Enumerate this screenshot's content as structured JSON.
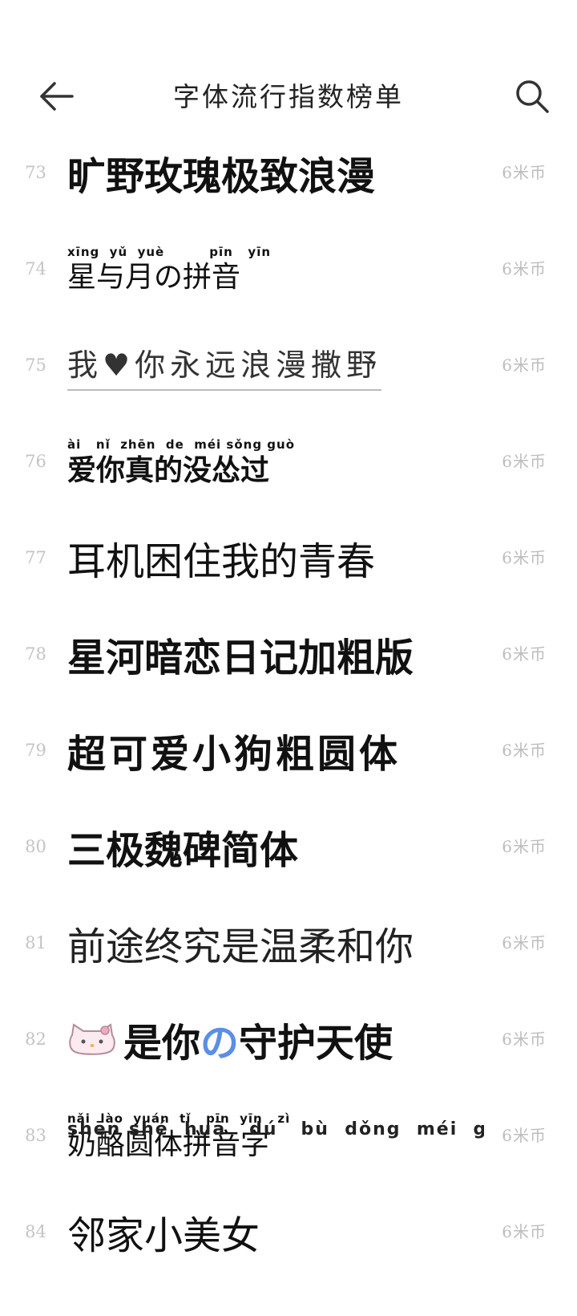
{
  "header": {
    "title": "字体流行指数榜单",
    "back_icon": "arrow-left-icon",
    "search_icon": "search-icon"
  },
  "fonts": [
    {
      "rank": "73",
      "name": "旷野玫瑰极致浪漫",
      "price": "6米币",
      "style": "bold"
    },
    {
      "rank": "74",
      "name": "星与月の拼音",
      "pinyin": "xīng  yǔ  yuè         pīn   yīn",
      "price": "6米币",
      "style": "pinyin-serif"
    },
    {
      "rank": "75",
      "name": "我♥你永远浪漫撒野",
      "price": "6米币",
      "style": "dash"
    },
    {
      "rank": "76",
      "name": "爱你真的没怂过",
      "pinyin": "ài   nǐ  zhēn  de  méi sǒng guò",
      "price": "6米币",
      "style": "pinyin-bold"
    },
    {
      "rank": "77",
      "name": "耳机困住我的青春",
      "price": "6米币",
      "style": "light"
    },
    {
      "rank": "78",
      "name": "星河暗恋日记加粗版",
      "price": "6米币",
      "style": "bold-sans"
    },
    {
      "rank": "79",
      "name": "超可爱小狗粗圆体",
      "price": "6米币",
      "style": "round"
    },
    {
      "rank": "80",
      "name": "三极魏碑简体",
      "price": "6米币",
      "style": "bold"
    },
    {
      "rank": "81",
      "name": "前途终究是温柔和你",
      "price": "6米币",
      "style": "thin"
    },
    {
      "rank": "82",
      "name_before": "是你",
      "name_mid": "の",
      "name_after": "守护天使",
      "price": "6米币",
      "style": "hello"
    },
    {
      "rank": "83",
      "name": "奶酪圆体拼音字",
      "pinyin": "nǎi  lào  yuán  tǐ   pīn  yīn   zì",
      "price": "6米币",
      "style": "pinyin-light"
    },
    {
      "rank": "84",
      "name": "邻家小美女",
      "price": "6米币",
      "style": "serif"
    }
  ],
  "partial_row": {
    "pinyin": "shēn shé  huā   dú   bù  dǒng  méi  guī   tǐ"
  },
  "colors": {
    "rank": "#c4c4c4",
    "price": "#bdbdbd",
    "accent_blue": "#5b8ee8"
  }
}
